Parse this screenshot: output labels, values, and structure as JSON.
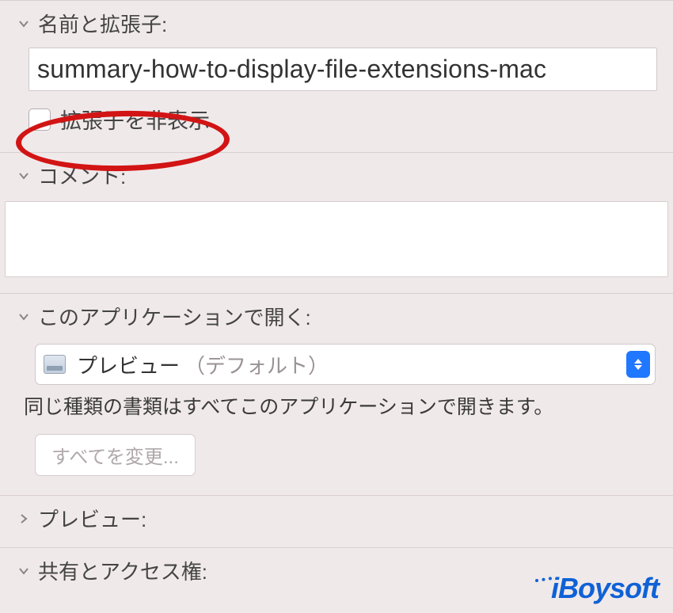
{
  "sections": {
    "name_ext": {
      "label": "名前と拡張子:"
    },
    "comment": {
      "label": "コメント:"
    },
    "open_with": {
      "label": "このアプリケーションで開く:"
    },
    "preview": {
      "label": "プレビュー:"
    },
    "sharing": {
      "label": "共有とアクセス権:"
    }
  },
  "filename": "summary-how-to-display-file-extensions-mac",
  "hide_extension": {
    "label": "拡張子を非表示",
    "checked": false
  },
  "open_with_app": {
    "name": "プレビュー",
    "default_suffix": "（デフォルト）"
  },
  "open_with_desc": "同じ種類の書類はすべてこのアプリケーションで開きます。",
  "change_all_label": "すべてを変更...",
  "watermark": "iBoysoft"
}
